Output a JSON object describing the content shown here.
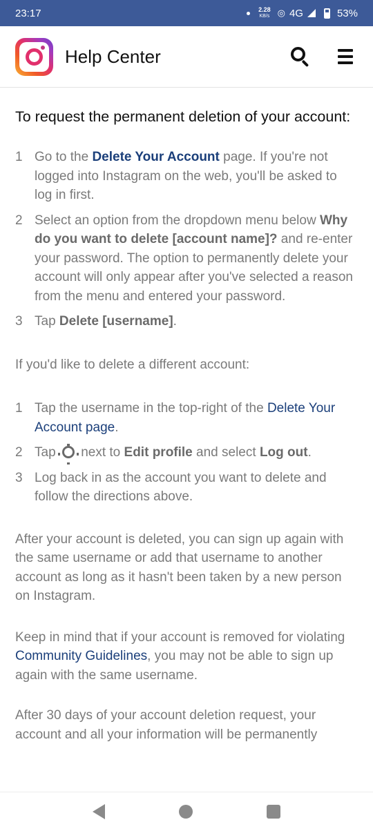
{
  "status_bar": {
    "time": "23:17",
    "speed_value": "2.28",
    "speed_unit": "KB/s",
    "network": "4G",
    "battery": "53%"
  },
  "header": {
    "logo_icon": "instagram-logo-icon",
    "title": "Help Center",
    "search_icon": "search-icon",
    "menu_icon": "hamburger-menu-icon"
  },
  "content": {
    "intro": "To request the permanent deletion of your account:",
    "steps_a": [
      {
        "num": "1",
        "pre": "Go to the ",
        "link": "Delete Your Account",
        "post": " page. If you're not logged into Instagram on the web, you'll be asked to log in first."
      },
      {
        "num": "2",
        "pre": "Select an option from the dropdown menu below ",
        "bold": "Why do you want to delete [account name]?",
        "post": " and re-enter your password. The option to permanently delete your account will only appear after you've selected a reason from the menu and entered your password."
      },
      {
        "num": "3",
        "pre": "Tap ",
        "bold": "Delete [username]",
        "post": "."
      }
    ],
    "different_account": "If you'd like to delete a different account:",
    "steps_b": [
      {
        "num": "1",
        "pre": "Tap the username in the top-right of the ",
        "link": "Delete Your Account page",
        "post": "."
      },
      {
        "num": "2",
        "pre": "Tap ",
        "mid": " next to ",
        "bold1": "Edit profile",
        "and": " and select ",
        "bold2": "Log out",
        "post": "."
      },
      {
        "num": "3",
        "text": "Log back in as the account you want to delete and follow the directions above."
      }
    ],
    "after_deleted": "After your account is deleted, you can sign up again with the same username or add that username to another account as long as it hasn't been taken by a new person on Instagram.",
    "keep_in_mind": {
      "pre": "Keep in mind that if your account is removed for violating ",
      "link": "Community Guidelines",
      "post": ", you may not be able to sign up again with the same username."
    },
    "after_30_days": "After 30 days of your account deletion request, your account and all your information will be permanently"
  },
  "navbar": {
    "back_icon": "back-triangle-icon",
    "home_icon": "home-circle-icon",
    "recents_icon": "recents-square-icon"
  }
}
